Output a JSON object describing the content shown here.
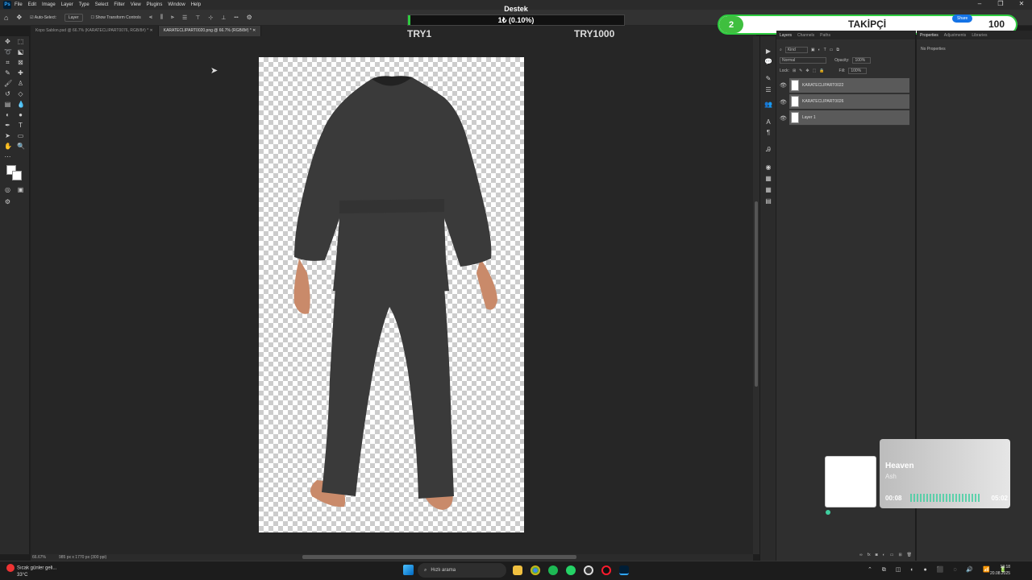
{
  "menu": {
    "app_logo": "Ps",
    "items": [
      "File",
      "Edit",
      "Image",
      "Layer",
      "Type",
      "Select",
      "Filter",
      "View",
      "Plugins",
      "Window",
      "Help"
    ],
    "window_controls": [
      "–",
      "❐",
      "✕"
    ]
  },
  "options_bar": {
    "auto_select": "Auto-Select:",
    "layer_select": "Layer",
    "transform_controls": "Show Transform Controls",
    "more": "•••"
  },
  "stream_overlay": {
    "title": "Destek",
    "progress_text": "1₺ (0.10%)",
    "progress_percent": 0.1,
    "min_label": "TRY1",
    "max_label": "TRY1000",
    "follower_count": "2",
    "follower_label": "TAKİPÇİ",
    "follower_target": "100",
    "follower_fraction": 0.02
  },
  "document_tabs": [
    {
      "label": "Kopo Sablon.psd @ 66.7% (KARATECLIPART0076, RGB/8#) *",
      "active": false
    },
    {
      "label": "KARATECLIPART0020.png @ 66.7% (RGB/8#) *",
      "active": true
    }
  ],
  "status_bar": {
    "zoom": "66.67%",
    "doc_info": "985 px x 1770 px (300 ppi)"
  },
  "layers_panel": {
    "tabs": [
      "Layers",
      "Channels",
      "Paths"
    ],
    "filter_kind": "Kind",
    "blend_mode": "Normal",
    "opacity_label": "Opacity:",
    "opacity_value": "100%",
    "lock_label": "Lock:",
    "fill_label": "Fill:",
    "fill_value": "100%",
    "layers": [
      {
        "name": "KARATECLIPART0022"
      },
      {
        "name": "KARATECLIPART0026"
      },
      {
        "name": "Layer 1"
      }
    ]
  },
  "properties_panel": {
    "tabs": [
      "Properties",
      "Adjustments",
      "Libraries"
    ],
    "empty_text": "No Properties",
    "share_button": "Share"
  },
  "music_widget": {
    "song": "Heaven",
    "artist": "Ash",
    "time_current": "00:08",
    "time_total": "05:02",
    "progress_fraction": 0.03
  },
  "taskbar": {
    "weather_text": "Sıcak günler geli...",
    "weather_temp": "33°C",
    "search_placeholder": "Hızlı arama",
    "time": "13:18",
    "date": "20.08.2025"
  },
  "colors": {
    "progress_green": "#2ecc40",
    "follower_green": "#3fbf3f",
    "ps_blue": "#31a8ff",
    "gi_color": "#3a3a3a",
    "skin": "#c98a6a"
  }
}
